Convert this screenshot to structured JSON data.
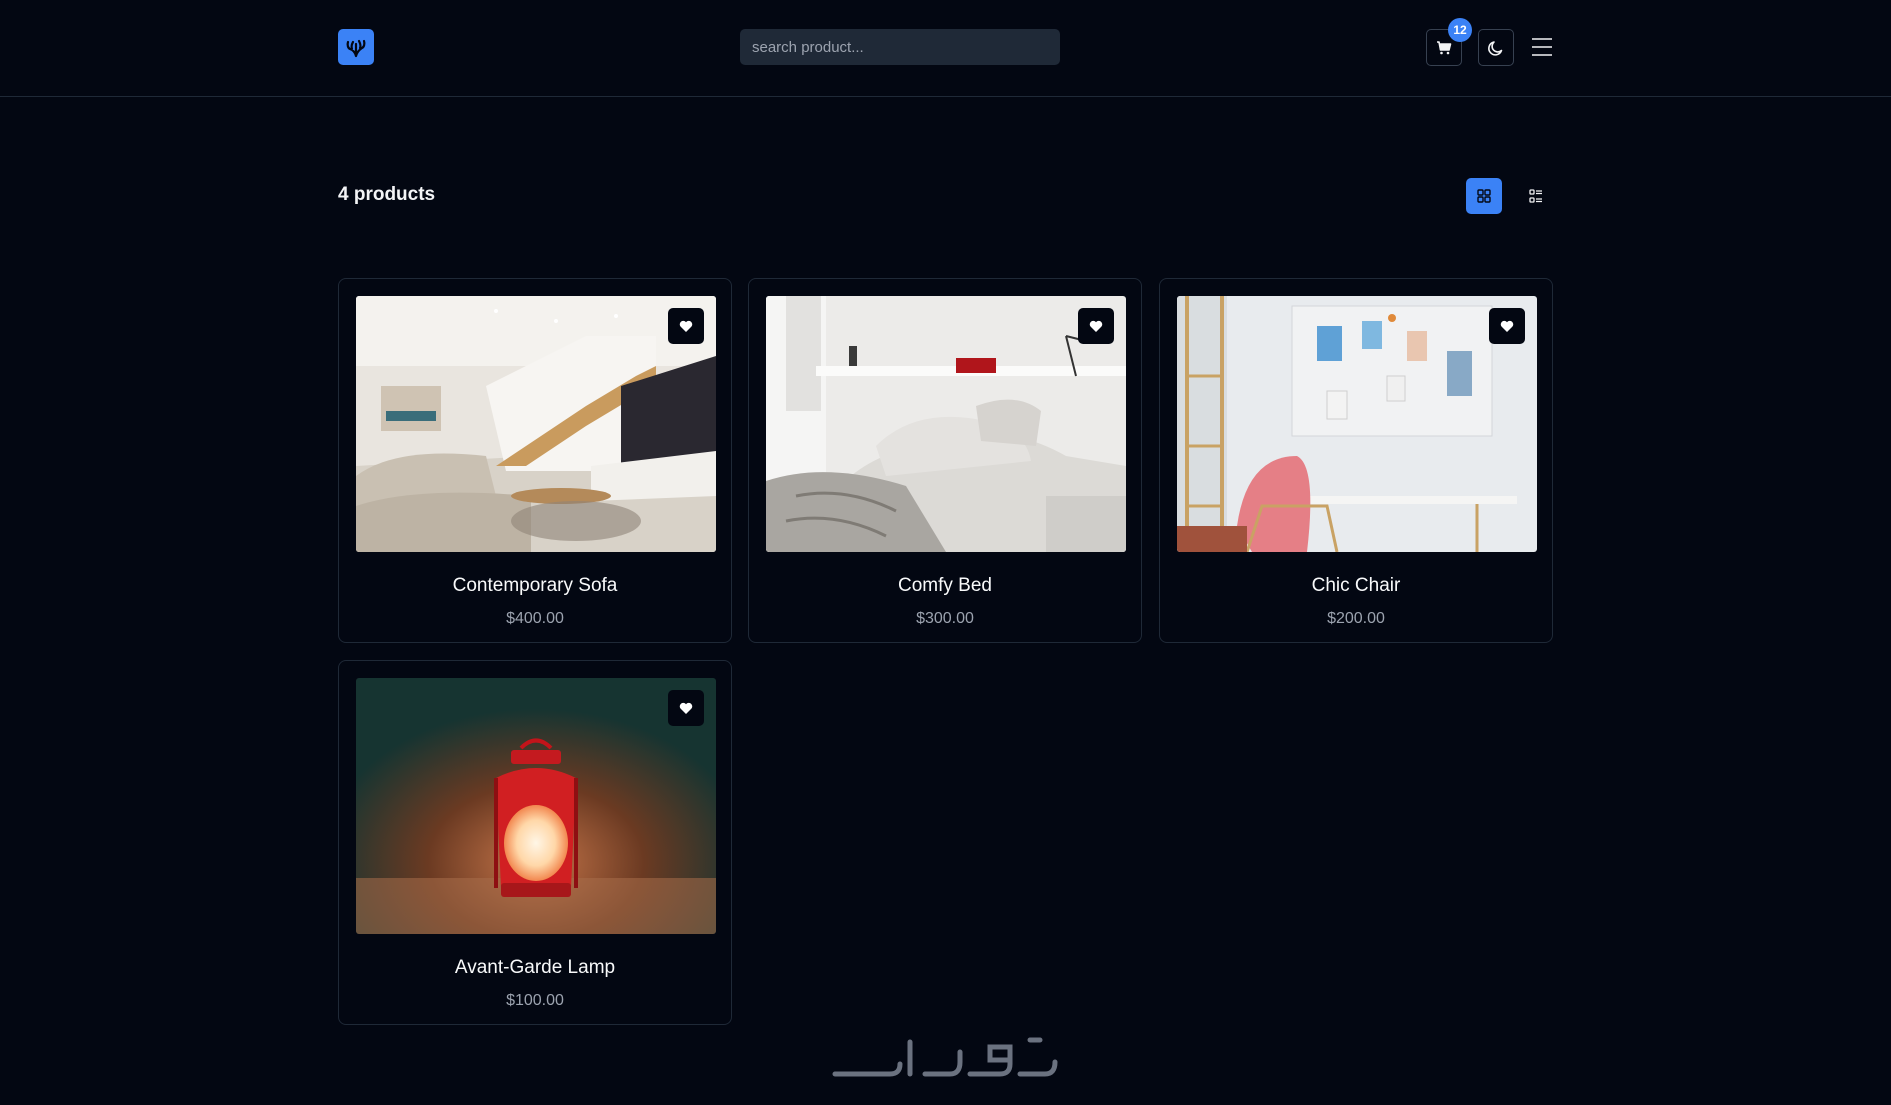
{
  "header": {
    "logo_icon": "coral-logo-icon",
    "search_placeholder": "search product...",
    "cart_count": "12",
    "cart_icon": "cart-icon",
    "theme_icon": "moon-icon",
    "menu_icon": "hamburger-menu-icon"
  },
  "toolbar": {
    "product_count": "4 products",
    "active_view": "grid"
  },
  "products": [
    {
      "name": "Contemporary Sofa",
      "price": "$400.00",
      "image": "living-room-sofa"
    },
    {
      "name": "Comfy Bed",
      "price": "$300.00",
      "image": "white-bedroom"
    },
    {
      "name": "Chic Chair",
      "price": "$200.00",
      "image": "desk-chair-studio"
    },
    {
      "name": "Avant-Garde Lamp",
      "price": "$100.00",
      "image": "red-lantern"
    }
  ],
  "colors": {
    "background": "#030712",
    "accent": "#3b82f6",
    "border": "#1f2937",
    "muted_text": "#9ca3af"
  }
}
